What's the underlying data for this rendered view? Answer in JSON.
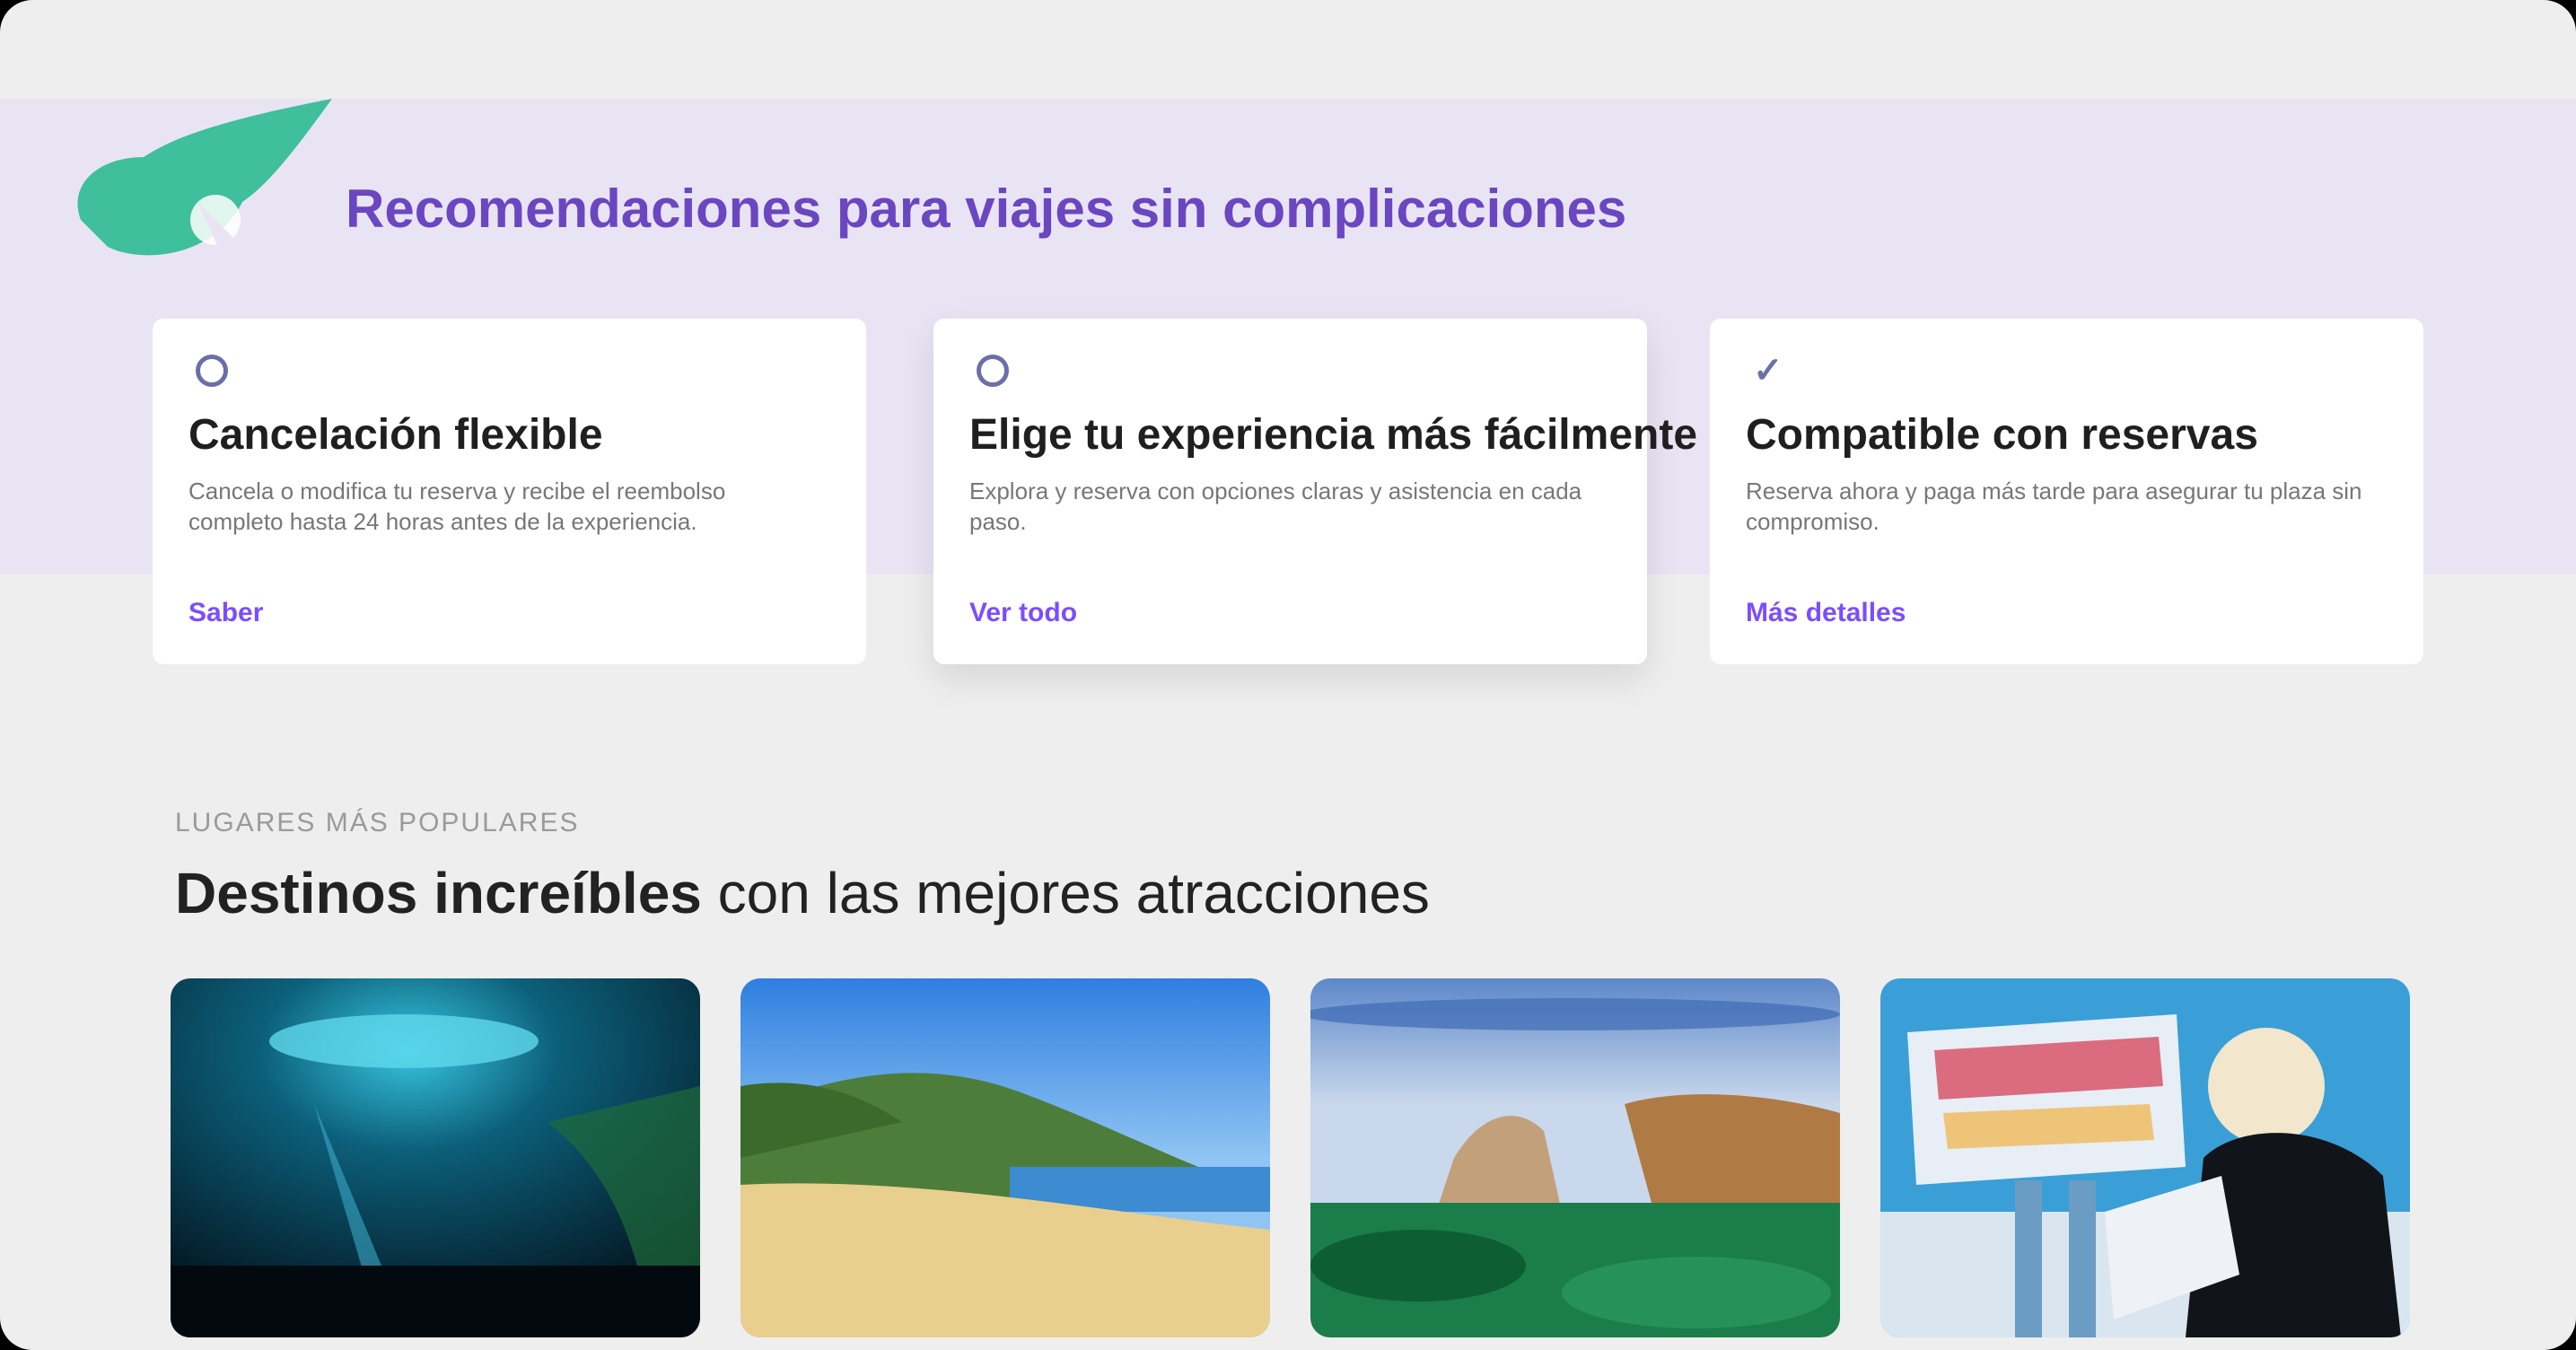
{
  "promo": {
    "title": "Recomendaciones para viajes sin complicaciones"
  },
  "cards": [
    {
      "icon": "circle-icon",
      "title": "Cancelación flexible",
      "description": "Cancela o modifica tu reserva y recibe el reembolso completo hasta 24 horas antes de la experiencia.",
      "link": "Saber"
    },
    {
      "icon": "circle-icon",
      "title": "Elige tu experiencia más fácilmente",
      "description": "Explora y reserva con opciones claras y asistencia en cada paso.",
      "link": "Ver todo"
    },
    {
      "icon": "check-icon",
      "title": "Compatible con reservas",
      "description": "Reserva ahora y paga más tarde para asegurar tu plaza sin compromiso.",
      "link": "Más detalles"
    }
  ],
  "section": {
    "eyebrow": "LUGARES MÁS POPULARES",
    "title_bold": "Destinos increíbles",
    "title_rest": " con las mejores atracciones"
  },
  "destinations": [
    {
      "name": "Underwater cenote",
      "icon": "photo-cenote"
    },
    {
      "name": "Tropical beach",
      "icon": "photo-beach"
    },
    {
      "name": "Coastal cliffs",
      "icon": "photo-cliffs"
    },
    {
      "name": "City sign",
      "icon": "photo-city"
    }
  ]
}
